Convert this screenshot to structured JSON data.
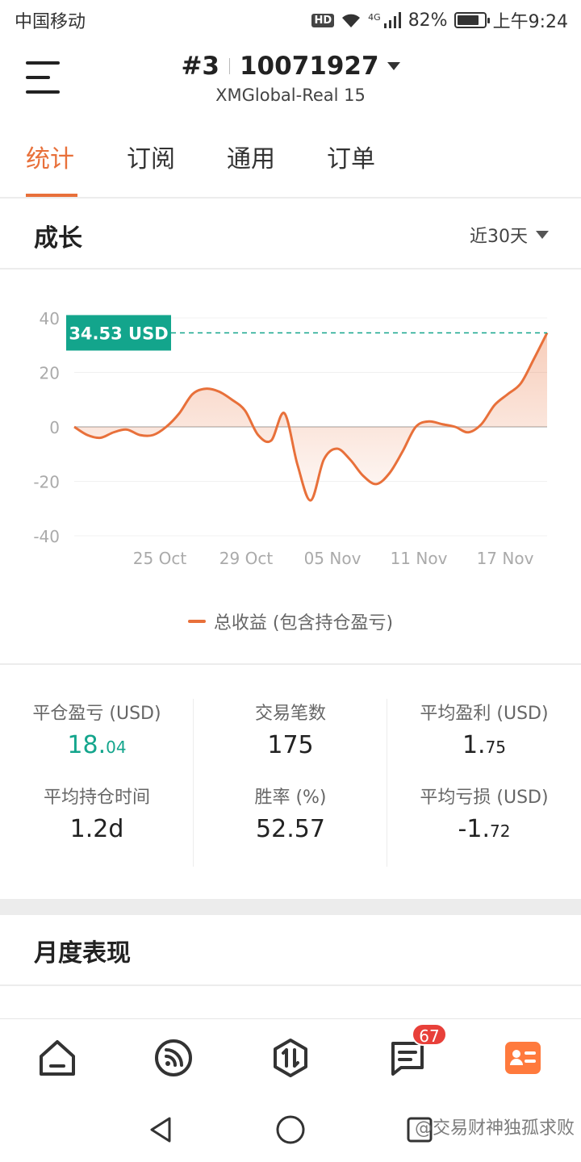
{
  "status_bar": {
    "carrier": "中国移动",
    "hd_label": "HD",
    "network": "4G",
    "battery_percent": "82%",
    "battery_level": 0.82,
    "time": "上午9:24"
  },
  "header": {
    "account_index": "#3",
    "account_number": "10071927",
    "server": "XMGlobal-Real 15"
  },
  "tabs": [
    {
      "label": "统计",
      "active": true
    },
    {
      "label": "订阅",
      "active": false
    },
    {
      "label": "通用",
      "active": false
    },
    {
      "label": "订单",
      "active": false
    }
  ],
  "growth": {
    "title": "成长",
    "period": "近30天"
  },
  "chart_data": {
    "type": "area",
    "current_label": "34.53 USD",
    "current_value": 34.53,
    "yticks": [
      "40",
      "20",
      "0",
      "-20",
      "-40"
    ],
    "xticks": [
      "25 Oct",
      "29 Oct",
      "05 Nov",
      "11 Nov",
      "17 Nov"
    ],
    "ylim": [
      -40,
      40
    ],
    "legend": "总收益 (包含持仓盈亏)",
    "series": [
      {
        "name": "总收益 (包含持仓盈亏)",
        "color": "#e8703a",
        "values": [
          0,
          -3,
          -4,
          -2,
          -1,
          -3,
          -3,
          0,
          5,
          12,
          14,
          13,
          10,
          6,
          -3,
          -5,
          5,
          -14,
          -27,
          -12,
          -8,
          -12,
          -18,
          -21,
          -17,
          -9,
          0,
          2,
          1,
          0,
          -2,
          1,
          8,
          12,
          16,
          25,
          34.53
        ]
      }
    ],
    "grid": true
  },
  "stats": [
    {
      "label": "平仓盈亏 (USD)",
      "int": "18.",
      "dec": "04",
      "highlight": true
    },
    {
      "label": "交易笔数",
      "int": "175",
      "dec": "",
      "highlight": false
    },
    {
      "label": "平均盈利 (USD)",
      "int": "1.",
      "dec": "75",
      "highlight": false
    },
    {
      "label": "平均持仓时间",
      "int": "1.2d",
      "dec": "",
      "highlight": false
    },
    {
      "label": "胜率 (%)",
      "int": "52.57",
      "dec": "",
      "highlight": false
    },
    {
      "label": "平均亏损 (USD)",
      "int": "-1.",
      "dec": "72",
      "highlight": false
    }
  ],
  "monthly": {
    "title": "月度表现"
  },
  "bottom_nav": {
    "items": [
      "home-icon",
      "feed-icon",
      "trade-icon",
      "messages-icon",
      "profile-icon"
    ],
    "badge": "67",
    "accent": "#ff7a3d"
  },
  "watermark": "@交易财神独孤求败"
}
